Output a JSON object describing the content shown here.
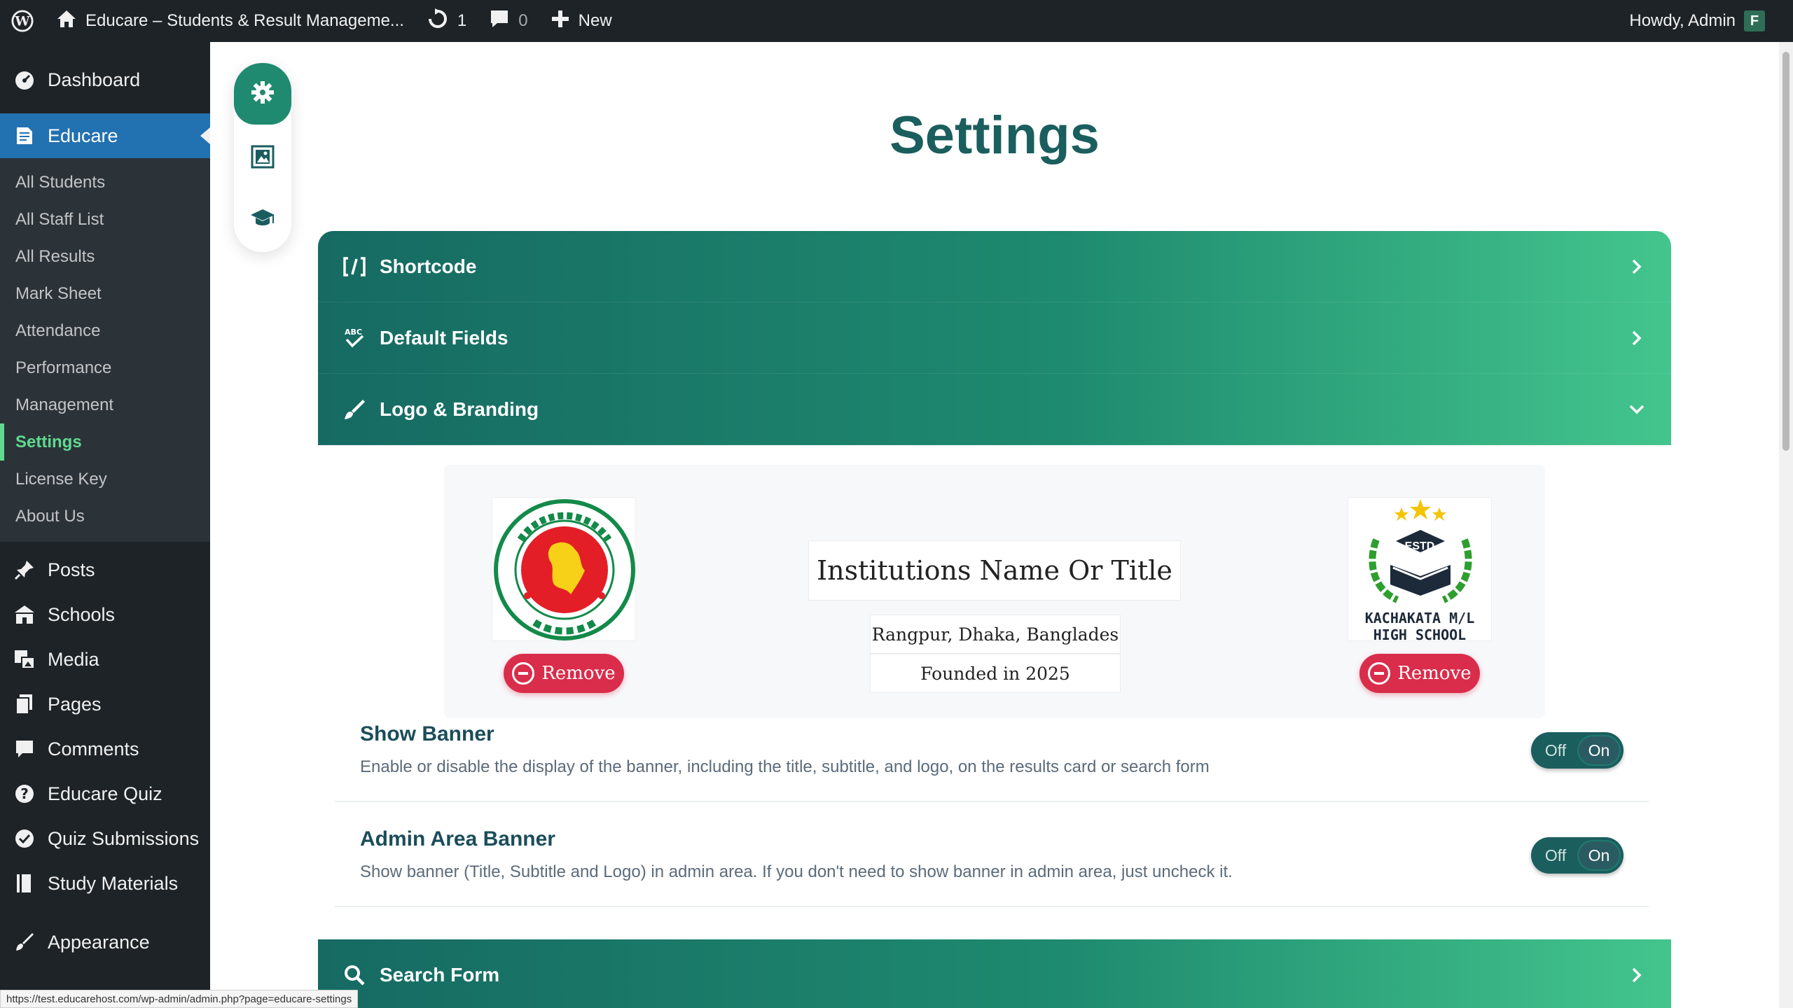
{
  "adminbar": {
    "site_name": "Educare – Students & Result Manageme...",
    "updates_count": "1",
    "comments_count": "0",
    "new_label": "New",
    "howdy": "Howdy, Admin",
    "avatar_letter": "F"
  },
  "sidebar": {
    "dashboard": "Dashboard",
    "educare": "Educare",
    "submenu": [
      "All Students",
      "All Staff List",
      "All Results",
      "Mark Sheet",
      "Attendance",
      "Performance",
      "Management",
      "Settings",
      "License Key",
      "About Us"
    ],
    "menu": [
      "Posts",
      "Schools",
      "Media",
      "Pages",
      "Comments",
      "Educare Quiz",
      "Quiz Submissions",
      "Study Materials",
      "Appearance"
    ]
  },
  "page": {
    "title": "Settings"
  },
  "accordion": {
    "shortcode": "Shortcode",
    "default_fields": "Default Fields",
    "logo_branding": "Logo & Branding",
    "search_form": "Search Form"
  },
  "banner": {
    "institution_title": "Institutions Name Or Title",
    "address": "Rangpur, Dhaka, Banglades",
    "founded": "Founded in 2025",
    "remove_label": "Remove",
    "right_logo_estd": "ESTD",
    "right_logo_line1": "KACHAKATA M/L",
    "right_logo_line2": "HIGH SCHOOL"
  },
  "settings": {
    "show_banner": {
      "title": "Show Banner",
      "desc": "Enable or disable the display of the banner, including the title, subtitle, and logo, on the results card or search form"
    },
    "admin_banner": {
      "title": "Admin Area Banner",
      "desc": "Show banner (Title, Subtitle and Logo) in admin area. If you don't need to show banner in admin area, just uncheck it."
    },
    "toggle_off": "Off",
    "toggle_on": "On"
  },
  "status_url": "https://test.educarehost.com/wp-admin/admin.php?page=educare-settings",
  "colors": {
    "accent": "#1f8a70",
    "wp_blue": "#2271b1",
    "remove_red": "#d92d4b",
    "active_green": "#5fd98f"
  }
}
